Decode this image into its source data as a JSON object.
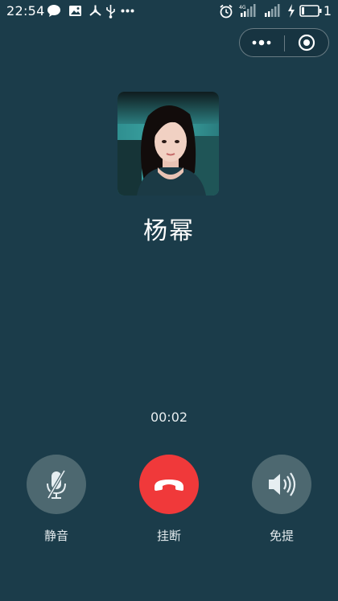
{
  "status_bar": {
    "time": "22:54",
    "network_label": "4G",
    "battery_text": "1",
    "icons": [
      "chat-bubble-icon",
      "image-icon",
      "share-icon",
      "usb-icon",
      "more-dots-icon",
      "alarm-icon",
      "signal-4g-icon",
      "signal-icon",
      "charging-icon",
      "battery-icon"
    ]
  },
  "capsule": {
    "icons": [
      "more-icon",
      "close-target-icon"
    ]
  },
  "call": {
    "contact_name": "杨幂",
    "timer": "00:02",
    "controls": {
      "mute_label": "静音",
      "hangup_label": "挂断",
      "speaker_label": "免提"
    }
  },
  "colors": {
    "background": "#1b3c4a",
    "hangup": "#f0393a",
    "control_gray": "#4d6870"
  }
}
